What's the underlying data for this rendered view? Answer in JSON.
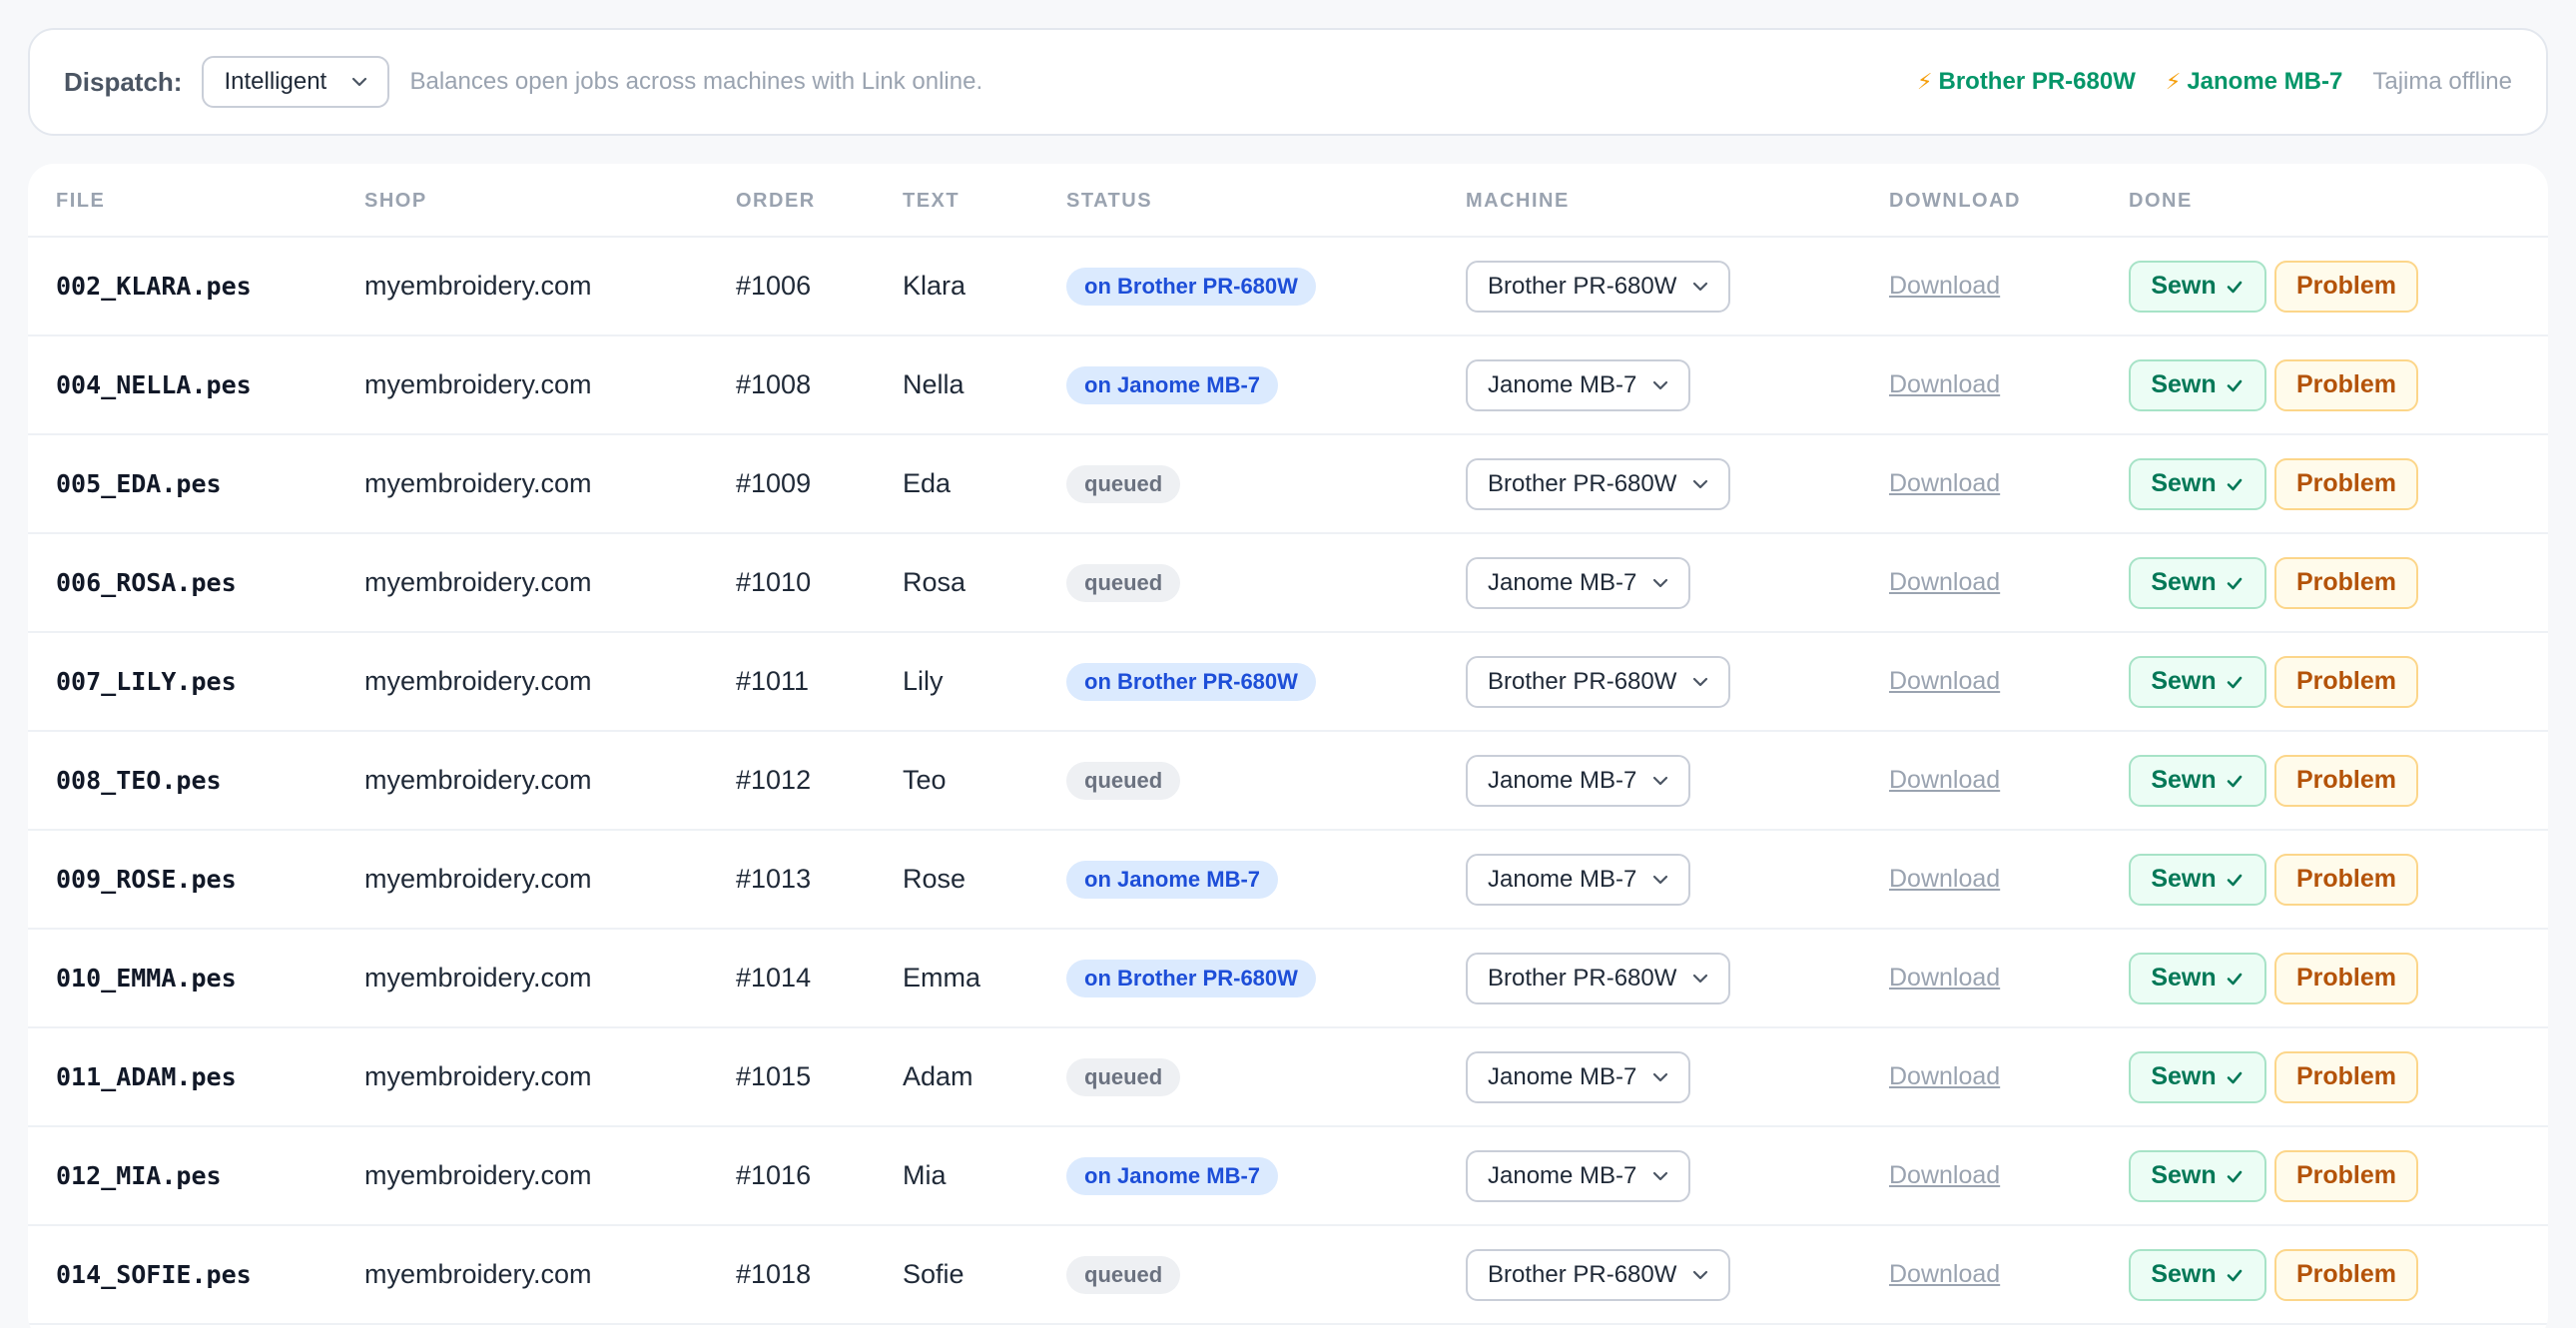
{
  "dispatch": {
    "label": "Dispatch:",
    "mode": "Intelligent",
    "description": "Balances open jobs across machines with Link online."
  },
  "machines": {
    "online": [
      {
        "icon": "⚡",
        "name": "Brother PR-680W"
      },
      {
        "icon": "⚡",
        "name": "Janome MB-7"
      }
    ],
    "offline": "Tajima offline"
  },
  "columns": {
    "file": "FILE",
    "shop": "SHOP",
    "order": "ORDER",
    "text": "TEXT",
    "status": "STATUS",
    "machine": "MACHINE",
    "download": "DOWNLOAD",
    "done": "DONE"
  },
  "actions": {
    "download": "Download",
    "sewn": "Sewn",
    "problem": "Problem"
  },
  "rows": [
    {
      "file": "002_KLARA.pes",
      "shop": "myembroidery.com",
      "order": "#1006",
      "text": "Klara",
      "status": "on Brother PR-680W",
      "status_type": "on",
      "machine": "Brother PR-680W"
    },
    {
      "file": "004_NELLA.pes",
      "shop": "myembroidery.com",
      "order": "#1008",
      "text": "Nella",
      "status": "on Janome MB-7",
      "status_type": "on",
      "machine": "Janome MB-7"
    },
    {
      "file": "005_EDA.pes",
      "shop": "myembroidery.com",
      "order": "#1009",
      "text": "Eda",
      "status": "queued",
      "status_type": "queued",
      "machine": "Brother PR-680W"
    },
    {
      "file": "006_ROSA.pes",
      "shop": "myembroidery.com",
      "order": "#1010",
      "text": "Rosa",
      "status": "queued",
      "status_type": "queued",
      "machine": "Janome MB-7"
    },
    {
      "file": "007_LILY.pes",
      "shop": "myembroidery.com",
      "order": "#1011",
      "text": "Lily",
      "status": "on Brother PR-680W",
      "status_type": "on",
      "machine": "Brother PR-680W"
    },
    {
      "file": "008_TEO.pes",
      "shop": "myembroidery.com",
      "order": "#1012",
      "text": "Teo",
      "status": "queued",
      "status_type": "queued",
      "machine": "Janome MB-7"
    },
    {
      "file": "009_ROSE.pes",
      "shop": "myembroidery.com",
      "order": "#1013",
      "text": "Rose",
      "status": "on Janome MB-7",
      "status_type": "on",
      "machine": "Janome MB-7"
    },
    {
      "file": "010_EMMA.pes",
      "shop": "myembroidery.com",
      "order": "#1014",
      "text": "Emma",
      "status": "on Brother PR-680W",
      "status_type": "on",
      "machine": "Brother PR-680W"
    },
    {
      "file": "011_ADAM.pes",
      "shop": "myembroidery.com",
      "order": "#1015",
      "text": "Adam",
      "status": "queued",
      "status_type": "queued",
      "machine": "Janome MB-7"
    },
    {
      "file": "012_MIA.pes",
      "shop": "myembroidery.com",
      "order": "#1016",
      "text": "Mia",
      "status": "on Janome MB-7",
      "status_type": "on",
      "machine": "Janome MB-7"
    },
    {
      "file": "014_SOFIE.pes",
      "shop": "myembroidery.com",
      "order": "#1018",
      "text": "Sofie",
      "status": "queued",
      "status_type": "queued",
      "machine": "Brother PR-680W"
    }
  ]
}
